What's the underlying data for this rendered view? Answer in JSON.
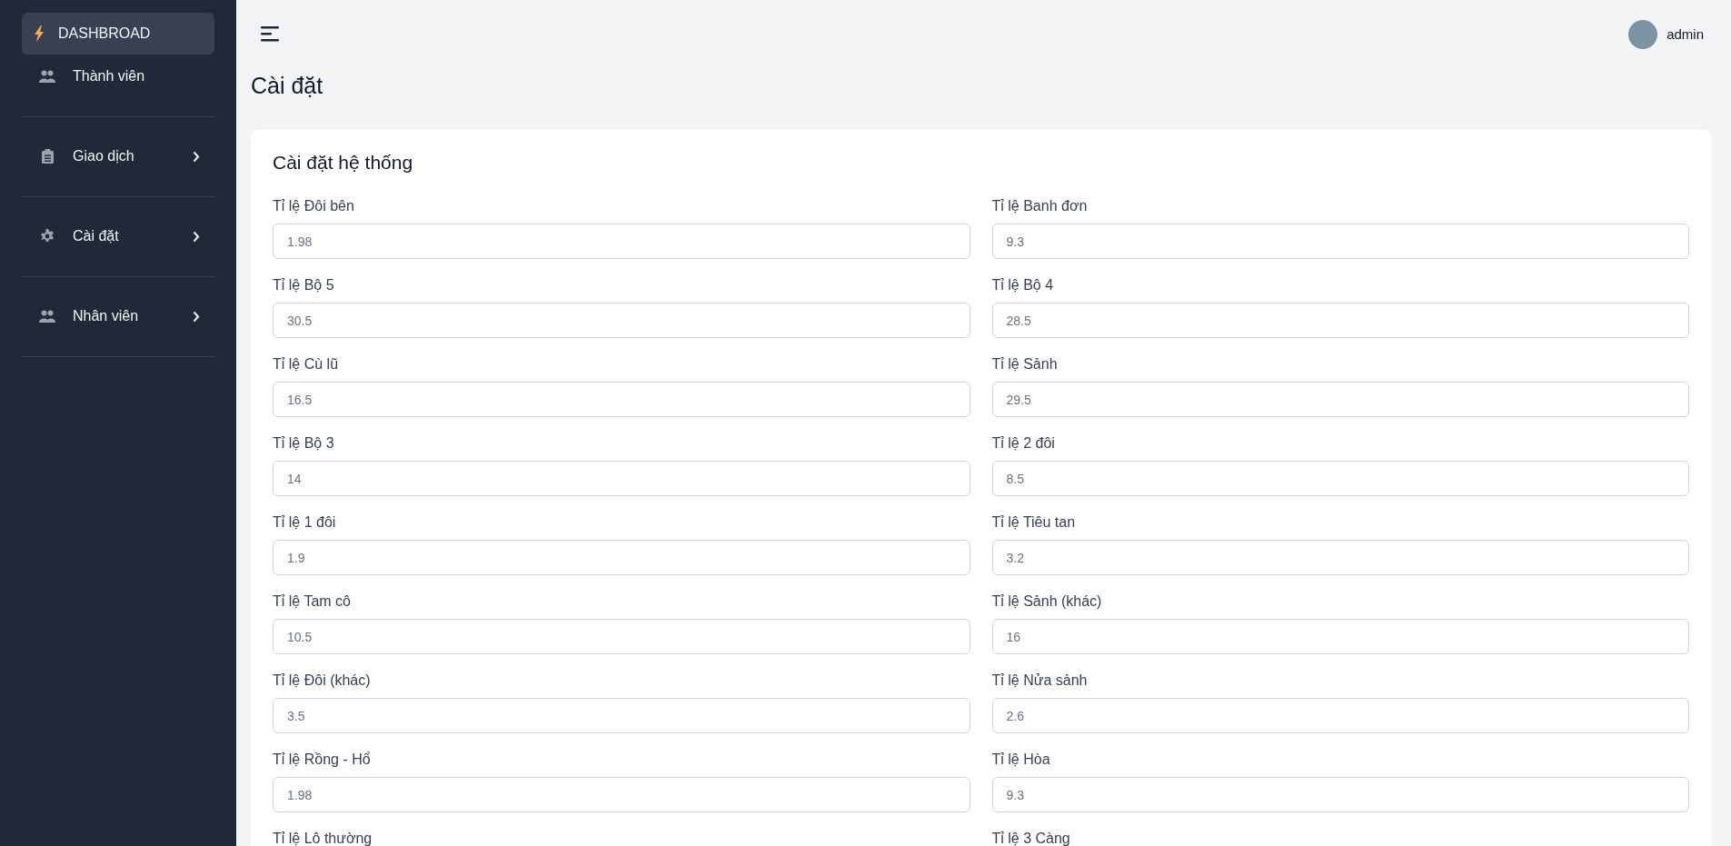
{
  "sidebar": {
    "items": [
      {
        "label": "DASHBROAD",
        "kind": "bolt",
        "selected": true,
        "expandable": false,
        "divider_after": false
      },
      {
        "label": "Thành viên",
        "kind": "users",
        "selected": false,
        "expandable": false,
        "divider_after": true
      },
      {
        "label": "Giao dịch",
        "kind": "clipboard",
        "selected": false,
        "expandable": true,
        "divider_after": true
      },
      {
        "label": "Cài đặt",
        "kind": "gear",
        "selected": false,
        "expandable": true,
        "divider_after": true
      },
      {
        "label": "Nhân viên",
        "kind": "users",
        "selected": false,
        "expandable": true,
        "divider_after": true
      }
    ]
  },
  "header": {
    "user": "admin"
  },
  "page_title": "Cài đặt",
  "card": {
    "title": "Cài đặt hệ thống",
    "fields": [
      {
        "label": "Tỉ lệ Đôi bên",
        "value": "1.98"
      },
      {
        "label": "Tỉ lệ Banh đơn",
        "value": "9.3"
      },
      {
        "label": "Tỉ lệ Bộ 5",
        "value": "30.5"
      },
      {
        "label": "Tỉ lệ Bộ 4",
        "value": "28.5"
      },
      {
        "label": "Tỉ lệ Cù lũ",
        "value": "16.5"
      },
      {
        "label": "Tỉ lệ Sảnh",
        "value": "29.5"
      },
      {
        "label": "Tỉ lệ Bộ 3",
        "value": "14"
      },
      {
        "label": "Tỉ lệ 2 đôi",
        "value": "8.5"
      },
      {
        "label": "Tỉ lệ 1 đôi",
        "value": "1.9"
      },
      {
        "label": "Tỉ lệ Tiêu tan",
        "value": "3.2"
      },
      {
        "label": "Tỉ lệ Tam cô",
        "value": "10.5"
      },
      {
        "label": "Tỉ lệ Sảnh (khác)",
        "value": "16"
      },
      {
        "label": "Tỉ lệ Đôi (khác)",
        "value": "3.5"
      },
      {
        "label": "Tỉ lệ Nửa sảnh",
        "value": "2.6"
      },
      {
        "label": "Tỉ lệ Rồng - Hổ",
        "value": "1.98"
      },
      {
        "label": "Tỉ lệ Hòa",
        "value": "9.3"
      },
      {
        "label": "Tỉ lệ Lô thường"
      },
      {
        "label": "Tỉ lệ 3 Càng"
      }
    ]
  }
}
